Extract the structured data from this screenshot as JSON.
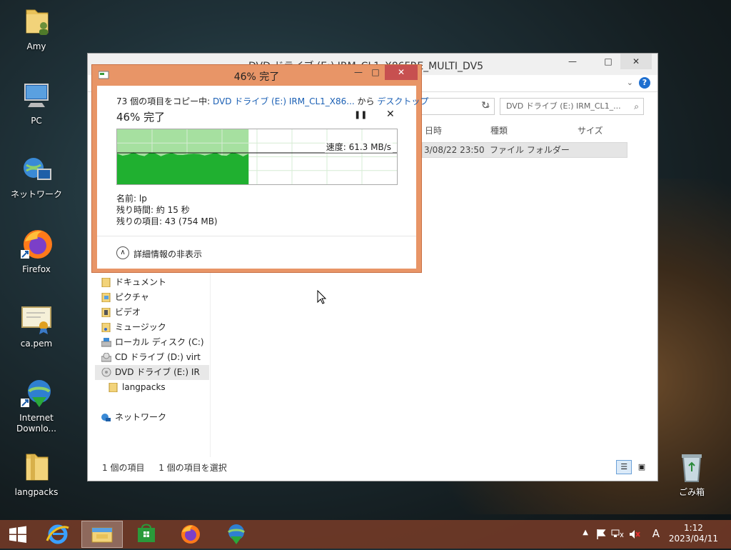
{
  "desktop": {
    "icons": [
      {
        "label": "Amy",
        "icon": "user-folder-icon"
      },
      {
        "label": "PC",
        "icon": "computer-icon"
      },
      {
        "label": "ネットワーク",
        "icon": "network-icon"
      },
      {
        "label": "Firefox",
        "icon": "firefox-icon"
      },
      {
        "label": "ca.pem",
        "icon": "certificate-icon"
      },
      {
        "label": "Internet Downlo...",
        "icon": "internet-download-manager-icon"
      },
      {
        "label": "langpacks",
        "icon": "folder-icon"
      },
      {
        "label": "ごみ箱",
        "icon": "recycle-bin-icon"
      }
    ]
  },
  "explorer": {
    "title": "DVD ドライブ (E:) IRM_CL1_X86FRE_MULTI_DV5",
    "search_placeholder": "DVD ドライブ (E:) IRM_CL1_...",
    "columns": {
      "date": "日時",
      "type": "種類",
      "size": "サイズ"
    },
    "row": {
      "date": "3/08/22 23:50",
      "type": "ファイル フォルダー"
    },
    "nav": [
      "ドキュメント",
      "ピクチャ",
      "ビデオ",
      "ミュージック",
      "ローカル ディスク (C:)",
      "CD ドライブ (D:) virt",
      "DVD ドライブ (E:) IR",
      "langpacks",
      "ネットワーク"
    ],
    "status_items": "1 個の項目",
    "status_selected": "1 個の項目を選択"
  },
  "copy_dialog": {
    "title": "46% 完了",
    "copy_prefix": "73 個の項目をコピー中: ",
    "source": "DVD ドライブ (E:) IRM_CL1_X86...",
    "from_to": " から ",
    "dest": "デスクトップ",
    "percent_text": "46% 完了",
    "progress": 0.46,
    "speed": "速度: 61.3 MB/s",
    "name": "名前: lp",
    "time_left": "残り時間: 約 15 秒",
    "items_left": "残りの項目: 43 (754 MB)",
    "less_details": "詳細情報の非表示"
  },
  "taskbar": {
    "apps": [
      "internet-explorer-icon",
      "file-explorer-icon",
      "store-icon",
      "firefox-icon",
      "internet-download-manager-icon"
    ],
    "ime": "A",
    "time": "1:12",
    "date": "2023/04/11"
  }
}
